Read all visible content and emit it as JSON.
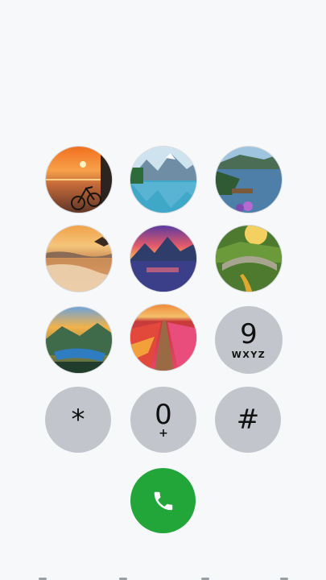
{
  "keypad": {
    "keys": [
      {
        "id": "1",
        "scene": "sunset-bicycle"
      },
      {
        "id": "2",
        "scene": "mountain-lake"
      },
      {
        "id": "3",
        "scene": "lake-boats"
      },
      {
        "id": "4",
        "scene": "beach-sunset"
      },
      {
        "id": "5",
        "scene": "mountain-sunset"
      },
      {
        "id": "6",
        "scene": "stone-bridge"
      },
      {
        "id": "7",
        "scene": "valley-river"
      },
      {
        "id": "8",
        "scene": "tulip-field"
      },
      {
        "id": "9",
        "digit": "9",
        "letters": "WXYZ"
      },
      {
        "id": "star",
        "digit": "*"
      },
      {
        "id": "0",
        "digit": "0",
        "sub": "+"
      },
      {
        "id": "hash",
        "digit": "#"
      }
    ]
  },
  "call_button": {
    "icon": "phone-icon",
    "color": "#22a63a"
  },
  "colors": {
    "key_bg": "#c2c6cc",
    "page_bg": "#f7f8fa"
  }
}
